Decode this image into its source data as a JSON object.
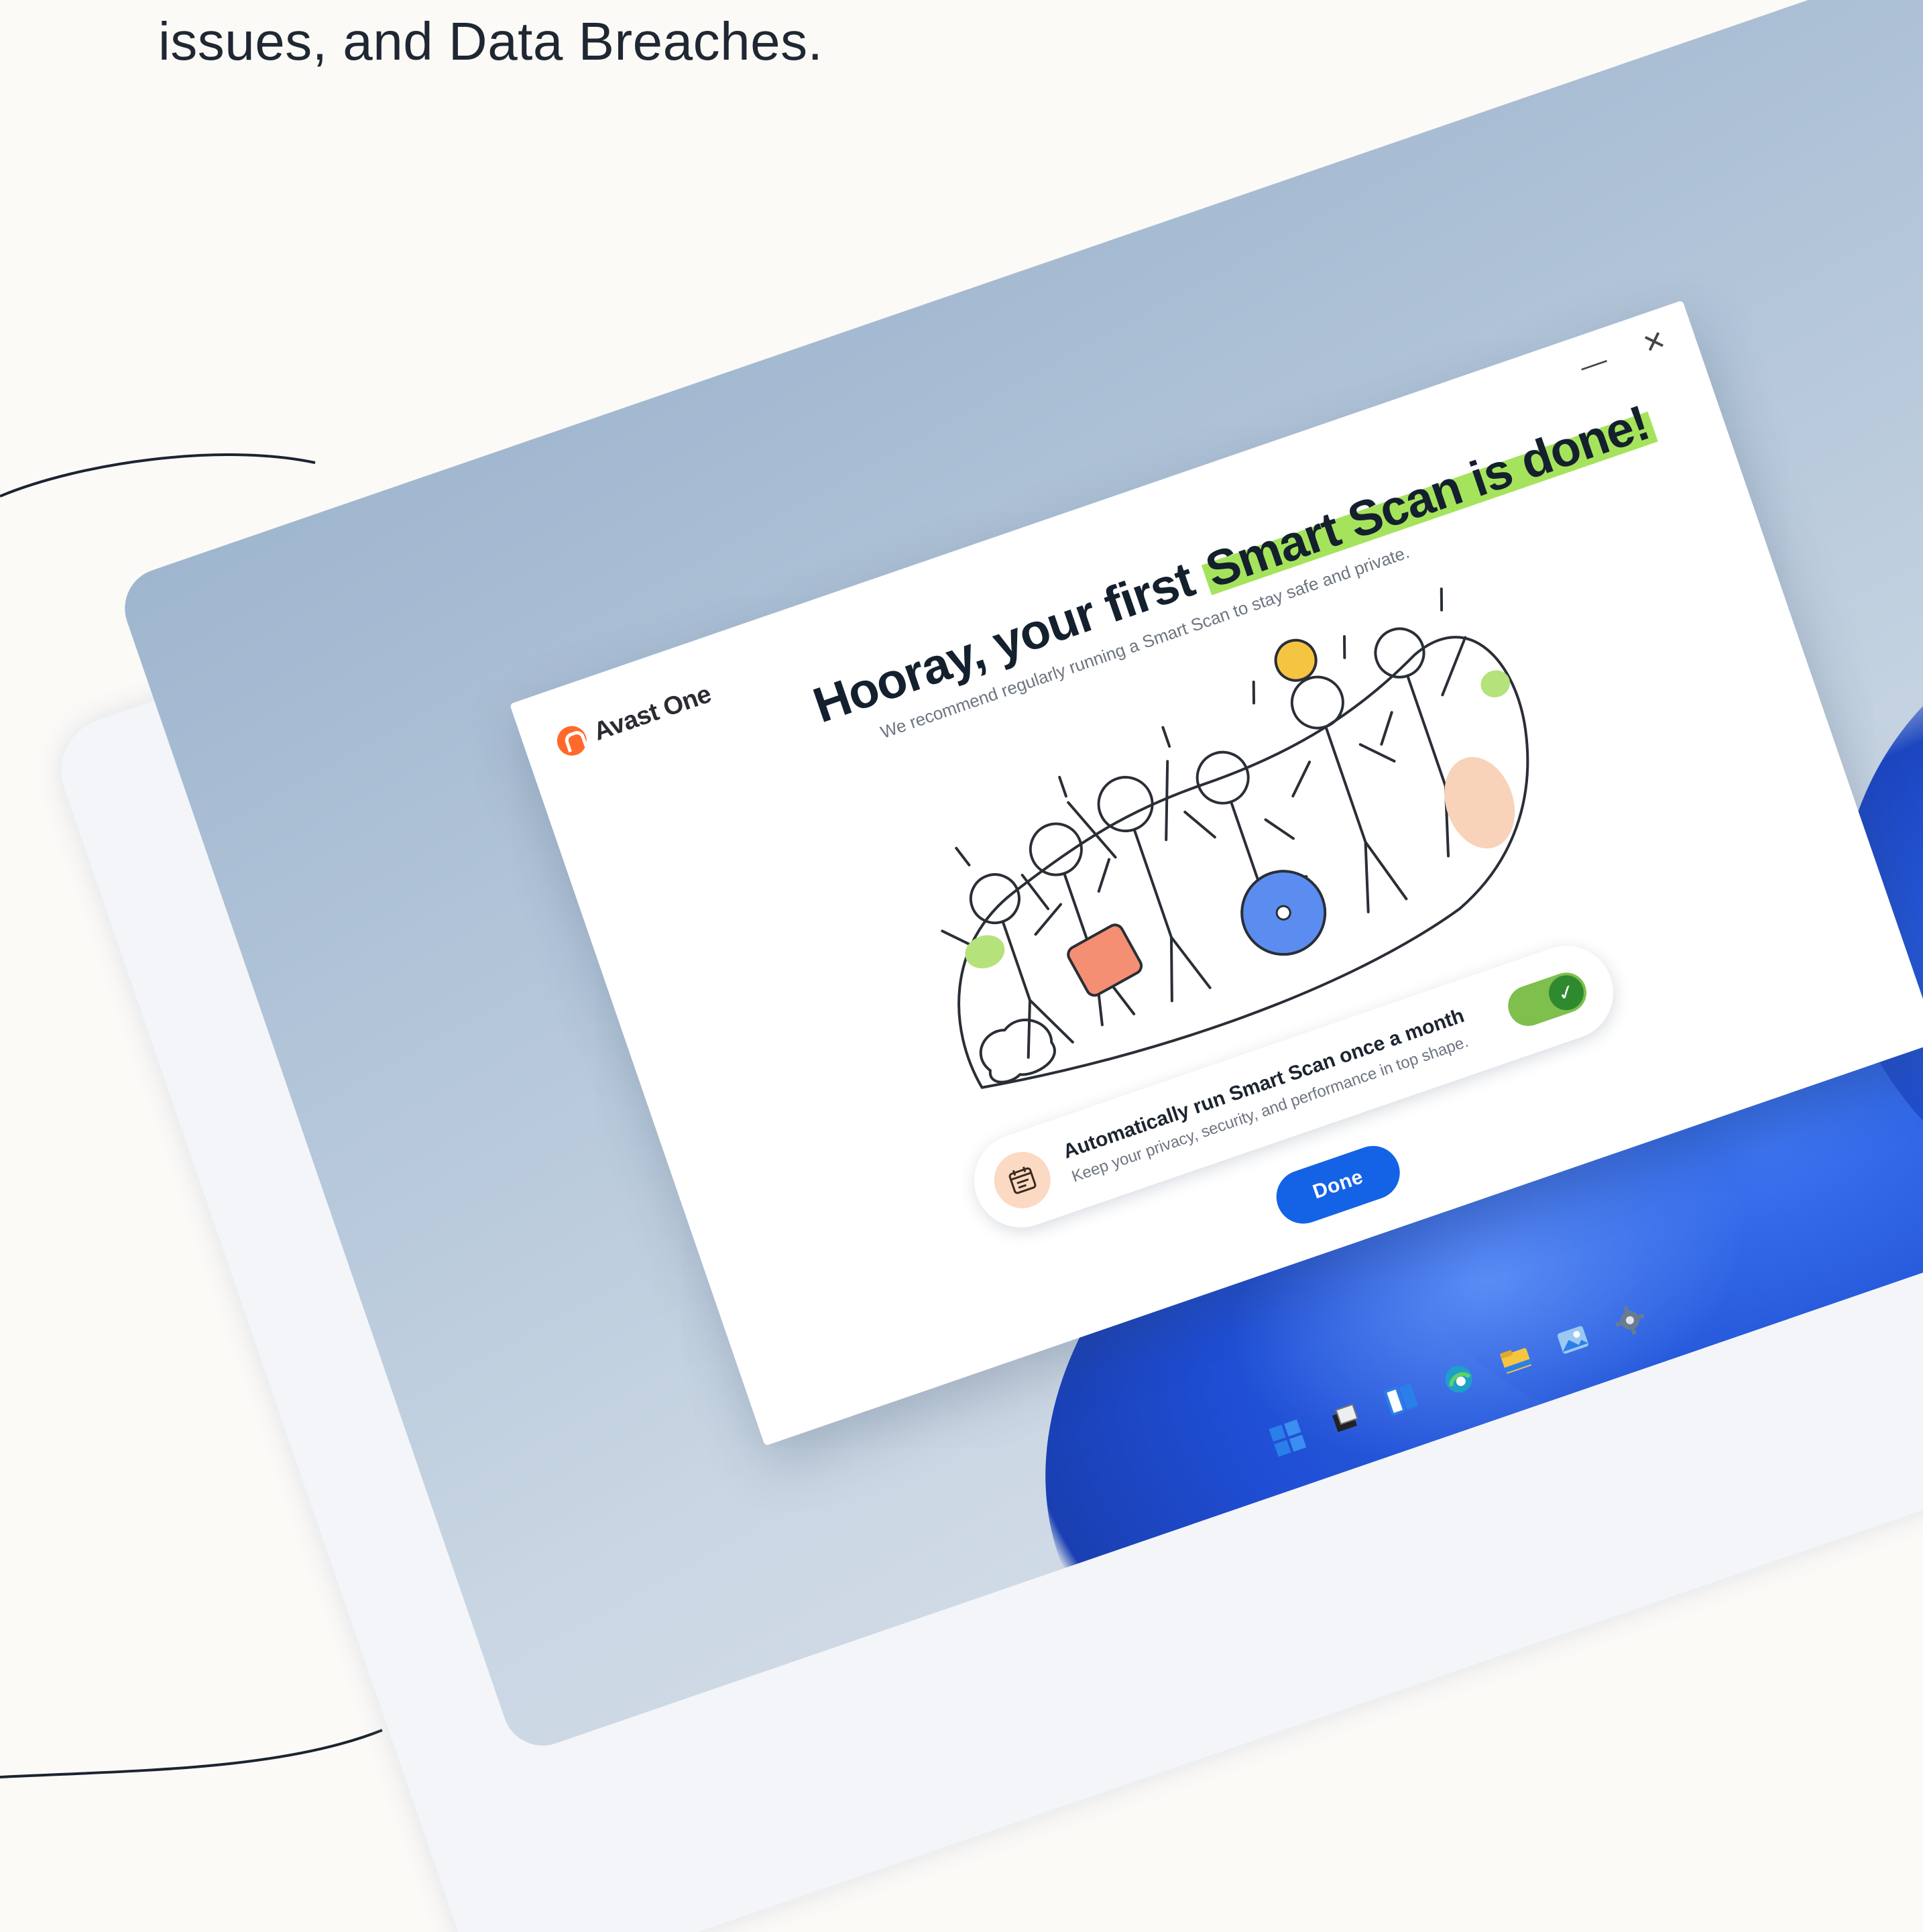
{
  "intro": {
    "text": "issues, and Data Breaches."
  },
  "dialog": {
    "brand": "Avast One",
    "title_prefix": "Hooray, your first ",
    "title_highlight": "Smart Scan is done!",
    "subtitle": "We recommend regularly running a Smart Scan to stay safe and private.",
    "minimize_symbol": "—",
    "close_symbol": "✕",
    "card": {
      "title": "Automatically run Smart Scan once a month",
      "description": "Keep your privacy, security, and performance in top shape.",
      "toggle_on": true,
      "toggle_check": "✓",
      "icon": "calendar-icon"
    },
    "done_label": "Done"
  },
  "taskbar": {
    "icons": [
      "windows-start-icon",
      "task-view-icon",
      "widgets-icon",
      "edge-browser-icon",
      "file-explorer-icon",
      "photos-icon",
      "settings-icon"
    ]
  },
  "colors": {
    "accent_blue": "#1463e6",
    "highlight_green": "#a6e35c",
    "toggle_green": "#7fbf4d",
    "brand_orange": "#ff6a2b",
    "page_bg": "#fcfaf7"
  }
}
